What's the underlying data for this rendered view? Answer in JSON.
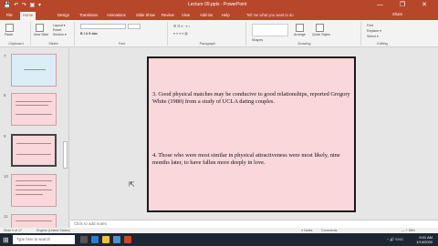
{
  "window": {
    "quick_access": "💾 ↶ ↷ ▣ ▾",
    "doc_title": "Lecture 09.pptx - PowerPoint",
    "controls": "— ❐ ✕"
  },
  "ribbon_tabs": [
    "File",
    "Home",
    "Design",
    "Transitions",
    "Animations",
    "Slide Show",
    "Review",
    "View",
    "Add-ins",
    "Help"
  ],
  "tell_me": "Tell me what you want to do",
  "share": "Share",
  "groups": {
    "clipboard": "Clipboard",
    "slides": "Slides",
    "font": "Font",
    "paragraph": "Paragraph",
    "drawing": "Drawing",
    "editing": "Editing",
    "paste": "Paste",
    "new_slide": "New Slide",
    "layout": "Layout ▾",
    "reset": "Reset",
    "section": "Section ▾",
    "find": "Find",
    "replace": "Replace ▾",
    "select": "Select ▾",
    "arrange": "Arrange",
    "quick_styles": "Quick Styles",
    "shapes": "Shapes"
  },
  "thumbnails": [
    {
      "num": "7",
      "style": "blue"
    },
    {
      "num": "8",
      "style": "pink"
    },
    {
      "num": "9",
      "style": "selected"
    },
    {
      "num": "10",
      "style": "pink"
    },
    {
      "num": "11",
      "style": "pink"
    }
  ],
  "slide": {
    "para1": "3. Good physical matches may be conducive to good relationships, reported Gregory White (1980) from a study of UCLA dating couples.",
    "para2": "4. Those who were most similar in physical attractiveness were most likely, nine months later, to have fallen more deeply in love."
  },
  "notes_placeholder": "Click to add notes",
  "status": {
    "slide": "Slide 9 of 17",
    "language": "English (United States)",
    "notes": "≡ Notes",
    "comments": "Comments",
    "zoom": "— + 56%"
  },
  "taskbar": {
    "search": "Type here to search",
    "time": "9:01 AM",
    "date": "1/14/2020",
    "tray": "^ 🔊 ENG"
  },
  "colors": {
    "accent": "#b7472a",
    "slide_bg": "#f9d7da"
  }
}
